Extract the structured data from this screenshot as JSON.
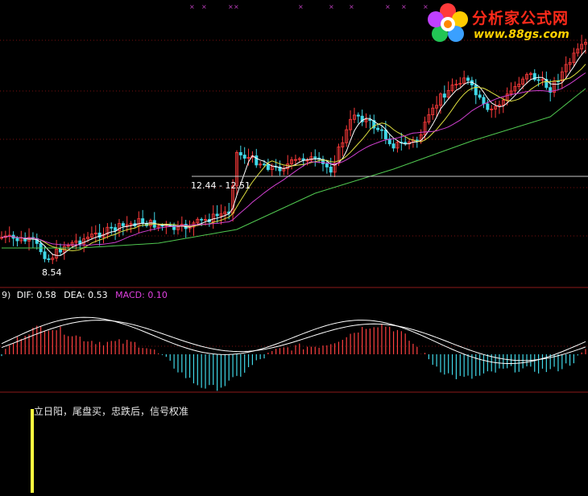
{
  "chart_data": [
    {
      "type": "candlestick",
      "y_marks": {
        "low_marker": 8.54,
        "range_label": "12.44 - 12.51",
        "reference_line": 12.5
      },
      "moving_averages": [
        "short MA (white)",
        "mid MA (yellow)",
        "mid MA (magenta)",
        "long MA (green)"
      ],
      "colors": {
        "up": "#ff3b3b",
        "down": "#40d8e8",
        "ma_white": "#ffffff",
        "ma_yellow": "#e0e040",
        "ma_magenta": "#d040d0",
        "ma_long": "#50c850",
        "ref_line": "#c8c8c8"
      }
    },
    {
      "type": "macd",
      "header_prefix": "9)",
      "dif_label": "DIF:",
      "dif_value": "0.58",
      "dea_label": "DEA:",
      "dea_value": "0.53",
      "macd_label": "MACD:",
      "macd_value": "0.10",
      "colors": {
        "dif": "#ffffff",
        "dea": "#ffffff",
        "pos_bar": "#ff4040",
        "neg_bar": "#40d8e8",
        "macd_label": "#e040e0"
      }
    },
    {
      "type": "indicator",
      "title": "立日阳，尾盘买，忠跌后，信号权准",
      "colors": {
        "bar": "#ffff40"
      }
    }
  ],
  "logo": {
    "title": "分析家公式网",
    "url": "www.88gs.com"
  },
  "ui": {
    "separator_color": "#8b1a1a",
    "dotted_grid_color": "#7a1010"
  }
}
